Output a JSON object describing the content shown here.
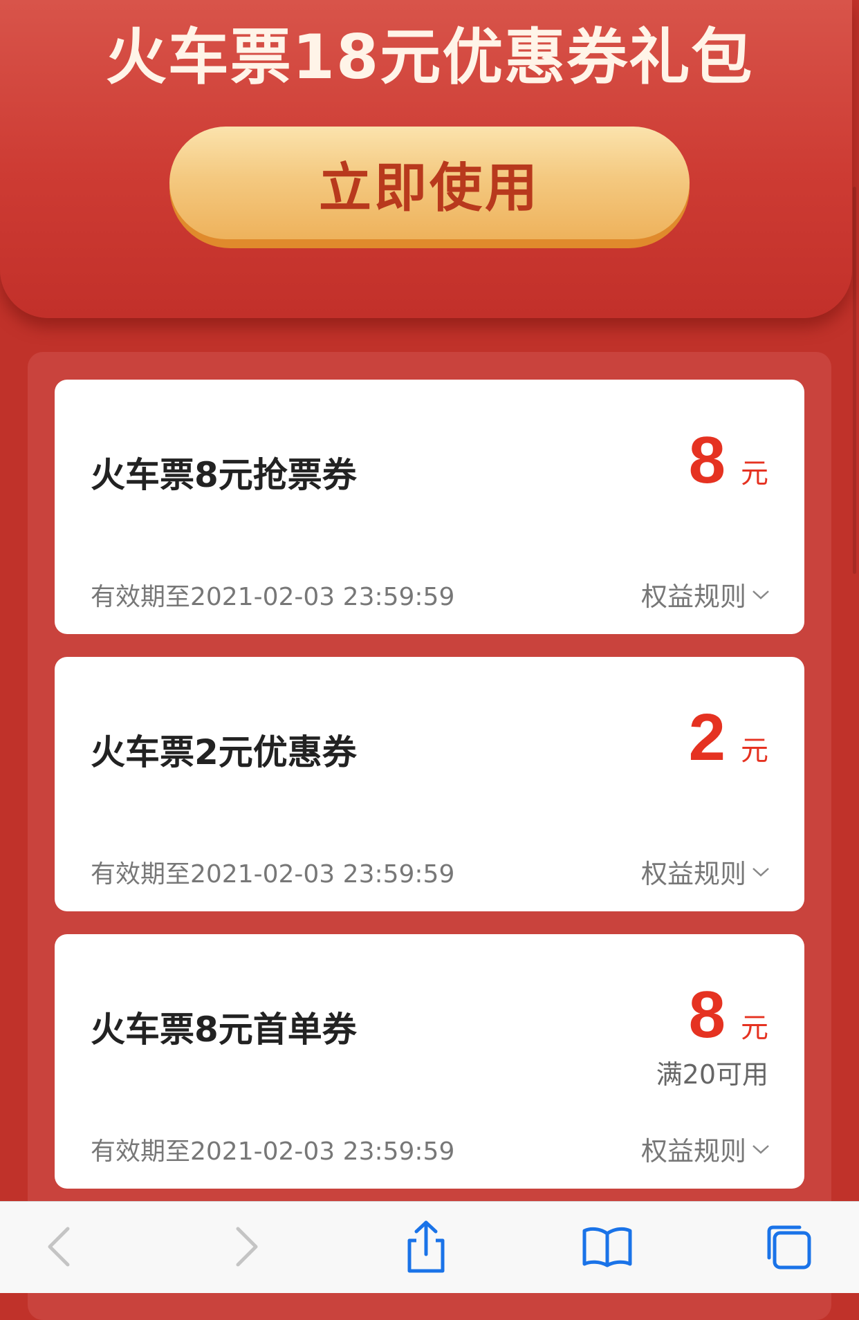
{
  "hero": {
    "title": "火车票18元优惠券礼包",
    "use_button_label": "立即使用"
  },
  "coupons": [
    {
      "name": "火车票8元抢票券",
      "amount": "8",
      "unit": "元",
      "condition": "",
      "validity": "有效期至2021-02-03 23:59:59",
      "rules_label": "权益规则"
    },
    {
      "name": "火车票2元优惠券",
      "amount": "2",
      "unit": "元",
      "condition": "",
      "validity": "有效期至2021-02-03 23:59:59",
      "rules_label": "权益规则"
    },
    {
      "name": "火车票8元首单券",
      "amount": "8",
      "unit": "元",
      "condition": "满20可用",
      "validity": "有效期至2021-02-03 23:59:59",
      "rules_label": "权益规则"
    }
  ],
  "toolbar": {
    "icons": [
      "back-icon",
      "forward-icon",
      "share-icon",
      "bookmarks-icon",
      "tabs-icon"
    ]
  },
  "colors": {
    "background": "#c0322a",
    "accent": "#e53221",
    "button": "#f4c980",
    "button_text": "#b8391d",
    "toolbar_icon": "#1a73e8",
    "toolbar_icon_disabled": "#c4c4c4"
  }
}
